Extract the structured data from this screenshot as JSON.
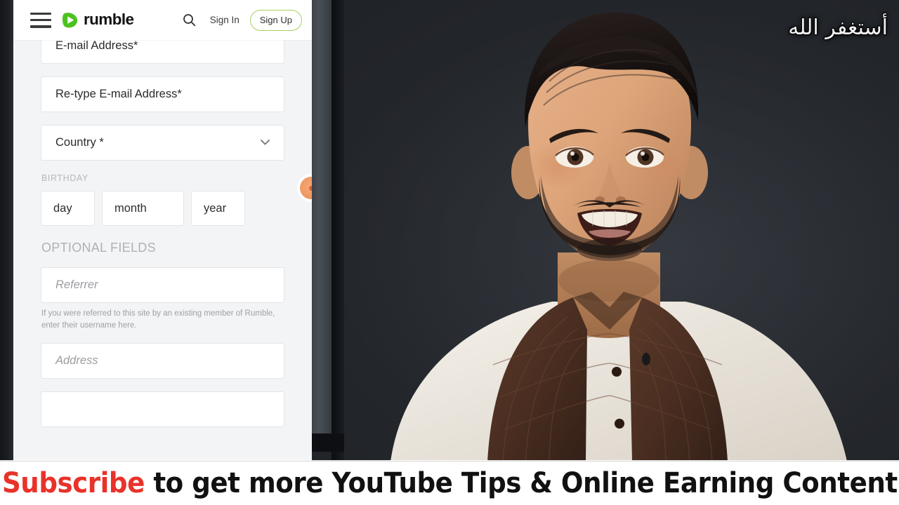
{
  "header": {
    "menu_icon": "hamburger-menu-icon",
    "brand": "rumble",
    "brand_icon": "rumble-play-logo-icon",
    "search_icon": "search-icon",
    "sign_in_label": "Sign In",
    "sign_up_label": "Sign Up",
    "sign_up_border_color": "#a8cf63",
    "brand_green": "#4cc21e"
  },
  "form": {
    "fields": [
      {
        "name": "email-address",
        "label": "E-mail Address*",
        "type": "text",
        "value": ""
      },
      {
        "name": "retype-email-address",
        "label": "Re-type E-mail Address*",
        "type": "text",
        "value": ""
      },
      {
        "name": "country",
        "label": "Country *",
        "type": "select",
        "chevron": "chevron-down-icon"
      }
    ],
    "birthday": {
      "section_label": "BIRTHDAY",
      "day_placeholder": "day",
      "month_placeholder": "month",
      "year_placeholder": "year"
    },
    "optional": {
      "section_label": "OPTIONAL FIELDS",
      "referrer_placeholder": "Referrer",
      "referrer_help": "If you were referred to this site by an existing member of Rumble, enter their username here.",
      "address_placeholder": "Address"
    },
    "badge": "orange-notification-badge"
  },
  "watermark": {
    "text": "أستغفر الله"
  },
  "caption": {
    "accent_word": "Subscribe",
    "rest": " to get more YouTube Tips & Online Earning Content",
    "accent_color": "#e8322a"
  }
}
